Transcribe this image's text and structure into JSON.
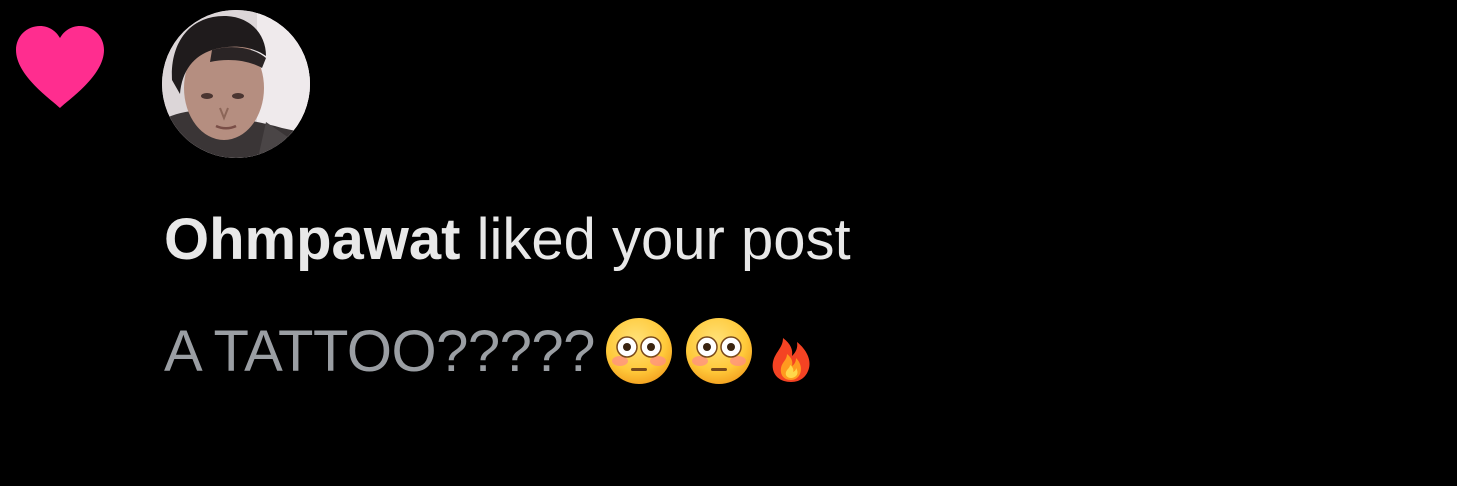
{
  "notification": {
    "username": "Ohmpawat",
    "action": " liked your post",
    "preview_text": "A TATTOO?????",
    "emojis": [
      "flushed-face-emoji",
      "flushed-face-emoji",
      "fire-emoji"
    ]
  },
  "icons": {
    "like": "heart-icon",
    "like_color": "#ff2d8f"
  },
  "colors": {
    "background": "#000000",
    "primary_text": "#e8e8e8",
    "secondary_text": "#9a9ea3"
  }
}
